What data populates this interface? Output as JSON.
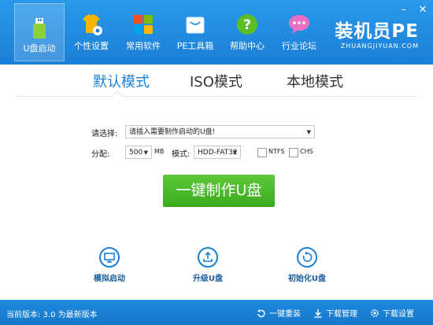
{
  "window": {
    "minimize": "–",
    "close": "✕"
  },
  "nav": [
    {
      "label": "U盘启动",
      "icon": "usb-icon",
      "active": true
    },
    {
      "label": "个性设置",
      "icon": "tshirt-gear-icon"
    },
    {
      "label": "常用软件",
      "icon": "tiles-icon"
    },
    {
      "label": "PE工具箱",
      "icon": "bag-icon"
    },
    {
      "label": "帮助中心",
      "icon": "help-icon"
    },
    {
      "label": "行业论坛",
      "icon": "chat-icon"
    }
  ],
  "brand": {
    "name": "装机员PE",
    "url": "ZHUANGJIYUAN.COM"
  },
  "modes": [
    {
      "label": "默认模式",
      "active": true
    },
    {
      "label": "ISO模式"
    },
    {
      "label": "本地模式"
    }
  ],
  "form": {
    "select_label": "请选择:",
    "select_value": "请插入需要制作启动的U盘!",
    "partition_label": "分配:",
    "partition_value": "500",
    "partition_unit": "MB",
    "mode_label": "模式:",
    "mode_value": "HDD-FAT32",
    "ntfs_label": "NTFS",
    "chs_label": "CHS"
  },
  "make_button": "一键制作U盘",
  "actions": [
    {
      "label": "模拟启动",
      "icon": "monitor-icon"
    },
    {
      "label": "升级U盘",
      "icon": "upload-icon"
    },
    {
      "label": "初始化U盘",
      "icon": "reset-icon"
    }
  ],
  "status": {
    "version": "当前版本: 3.0 为最新版本",
    "links": [
      {
        "label": "一键重装",
        "icon": "reinstall-icon"
      },
      {
        "label": "下载管理",
        "icon": "download-icon"
      },
      {
        "label": "下载设置",
        "icon": "settings-icon"
      }
    ]
  },
  "colors": {
    "header": "#1a7fd7",
    "accent": "#1a7fd7",
    "make_button": "#3aab1d"
  }
}
